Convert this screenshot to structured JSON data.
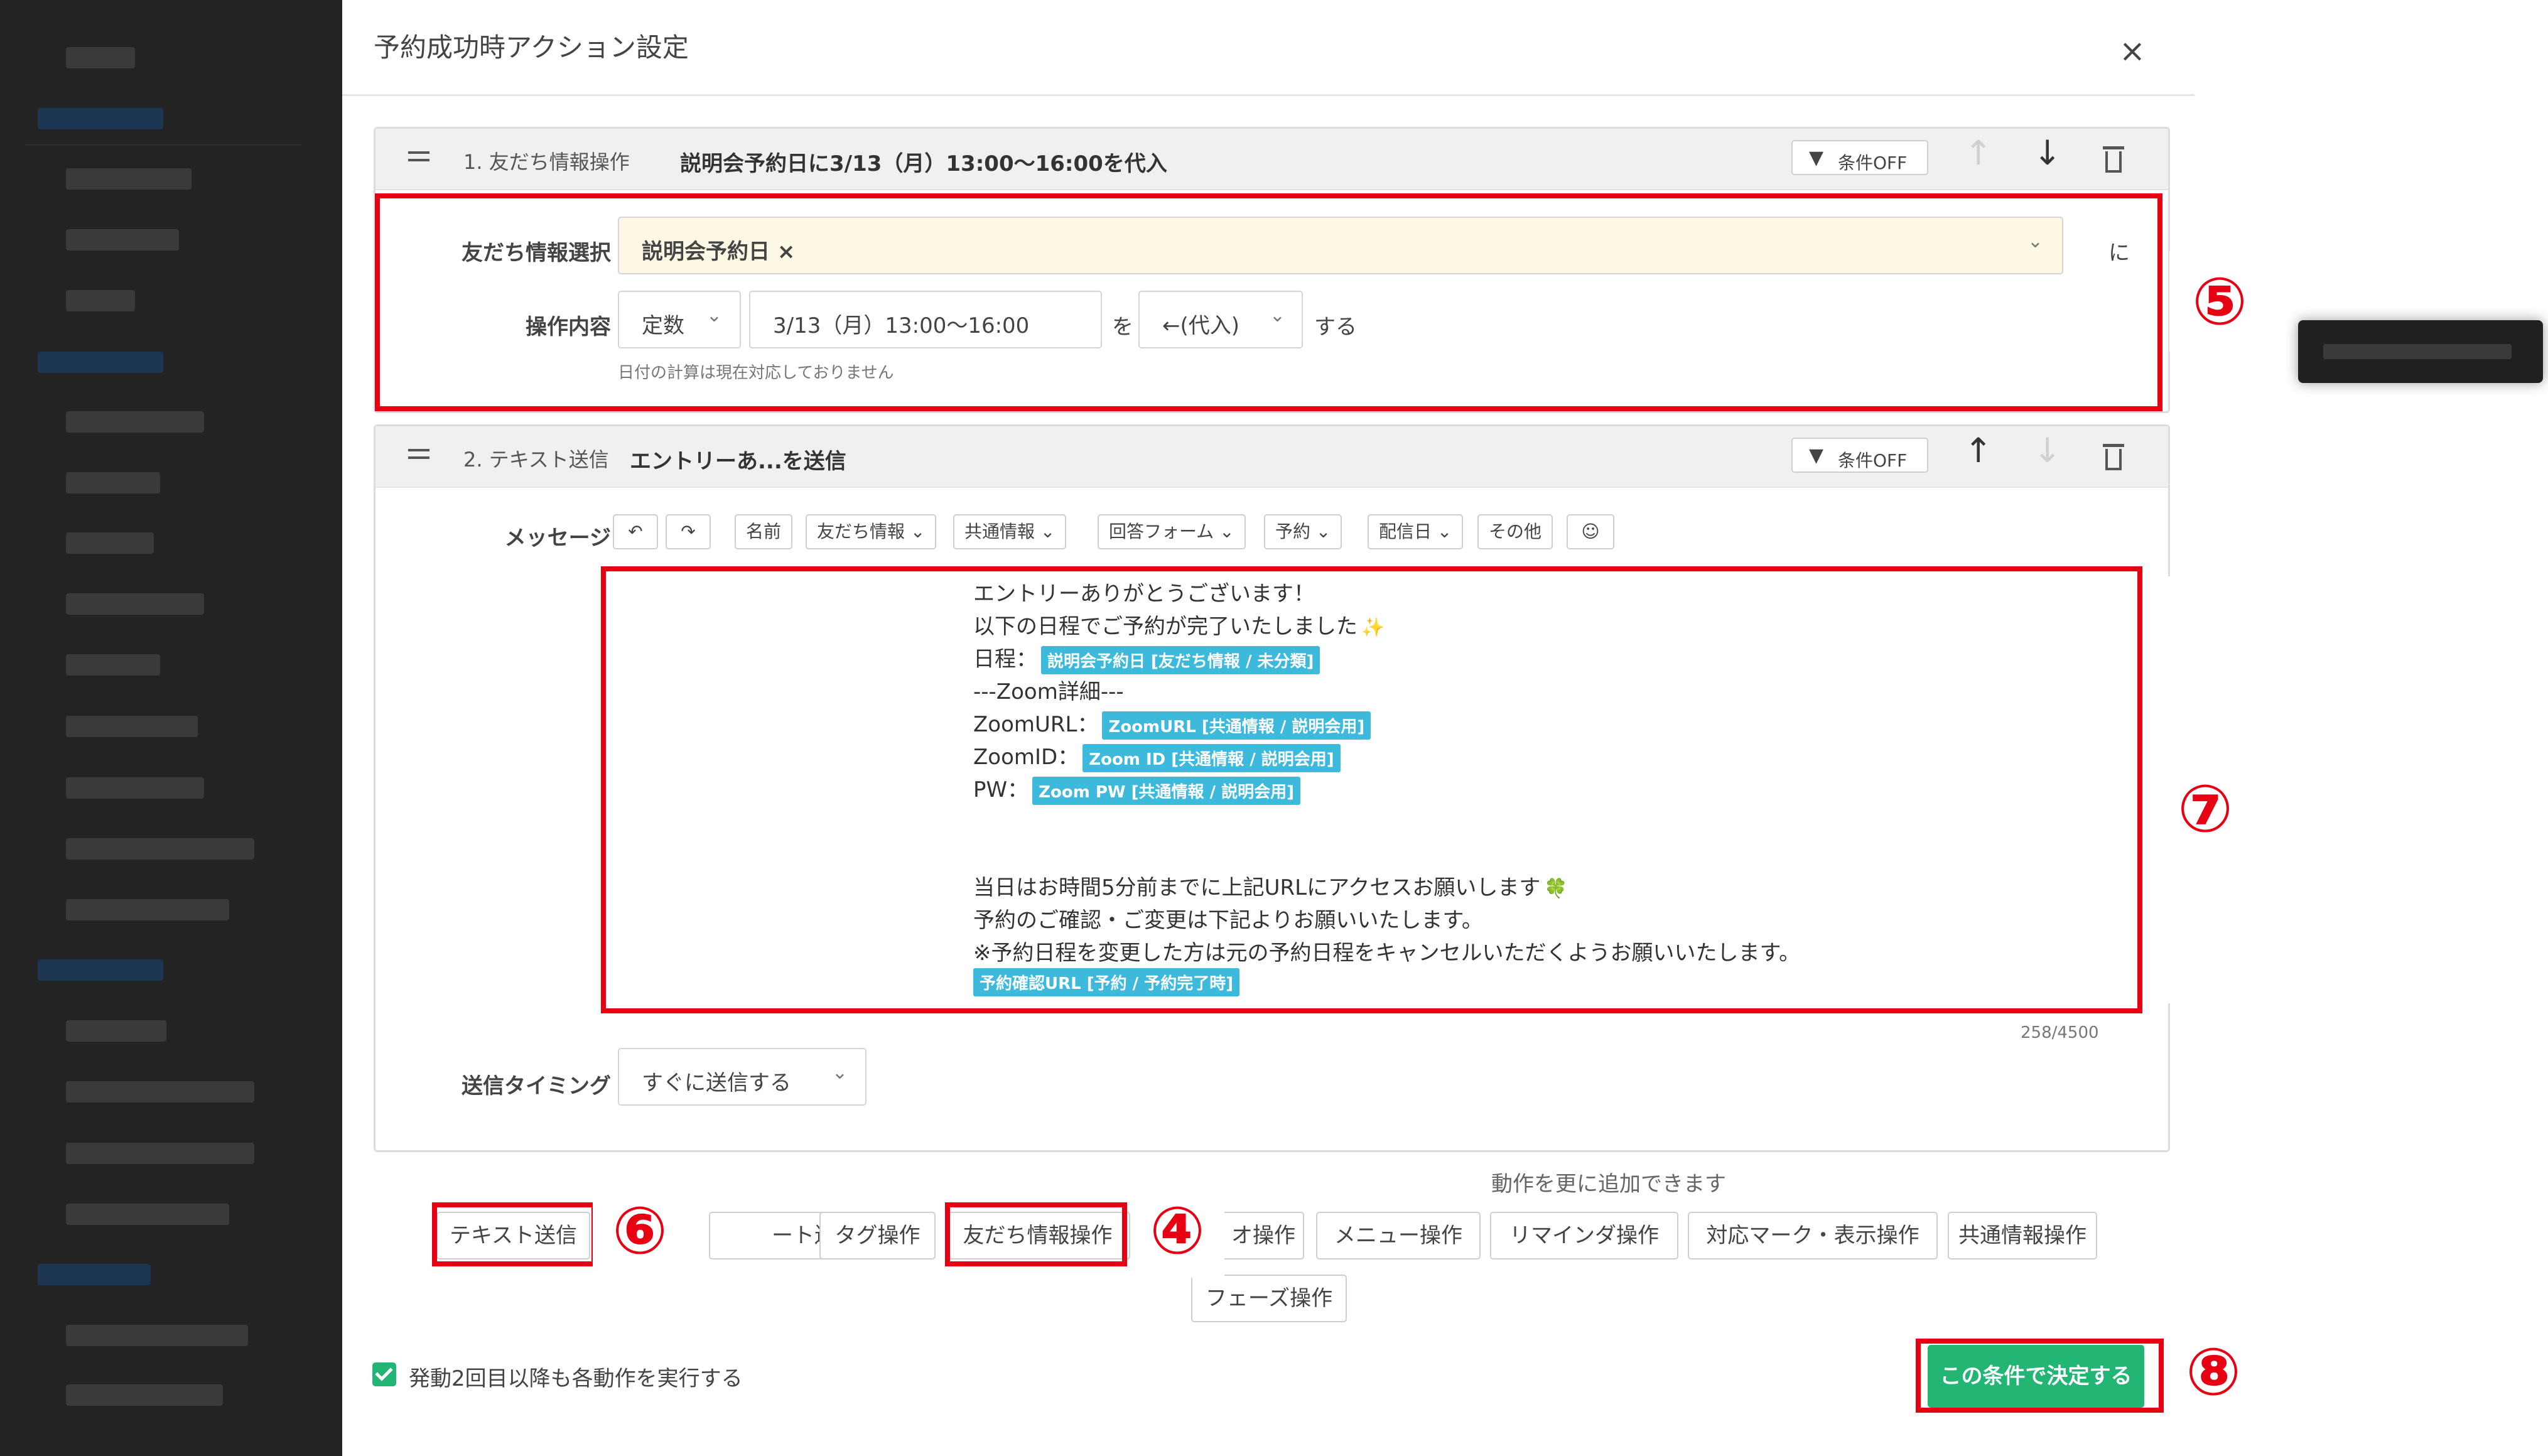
{
  "modal": {
    "title": "予約成功時アクション設定",
    "close_icon": "close-icon"
  },
  "action1": {
    "number": "1. 友だち情報操作",
    "summary": "説明会予約日に3/13（月）13:00〜16:00を代入",
    "condition_button": "条件OFF",
    "friend_info_label": "友だち情報選択",
    "friend_info_value": "説明会予約日",
    "friend_info_remove": "×",
    "friend_info_suffix": "に",
    "operation_label": "操作内容",
    "operation_type": "定数",
    "operation_value": "3/13（月）13:00〜16:00",
    "particle_wo": "を",
    "operation_mode": "←(代入)",
    "suru": "する",
    "note": "日付の計算は現在対応しておりません"
  },
  "action2": {
    "number": "2. テキスト送信",
    "summary": "エントリーあ...を送信",
    "condition_button": "条件OFF",
    "message_label": "メッセージ",
    "toolbar": {
      "undo": "↶",
      "redo": "↷",
      "name": "名前",
      "friend_info": "友だち情報",
      "shared_info": "共通情報",
      "answer_form": "回答フォーム",
      "reservation": "予約",
      "delivery_date": "配信日",
      "other": "その他",
      "emoji": "☺",
      "caret": "⌄"
    },
    "message": {
      "line1": "エントリーありがとうございます！",
      "line2": "以下の日程でご予約が完了いたしました",
      "line2_emoji": "✨",
      "line3_prefix": "日程：",
      "line3_tag": "説明会予約日 [友だち情報 / 未分類]",
      "line4": "---Zoom詳細---",
      "line5_prefix": "ZoomURL：",
      "line5_tag": "ZoomURL [共通情報 / 説明会用]",
      "line6_prefix": "ZoomID：",
      "line6_tag": "Zoom ID [共通情報 / 説明会用]",
      "line7_prefix": "PW：",
      "line7_tag": "Zoom PW [共通情報 / 説明会用]",
      "line8": "当日はお時間5分前までに上記URLにアクセスお願いします",
      "line8_emoji": "🍀",
      "line9": "予約のご確認・ご変更は下記よりお願いいたします。",
      "line10": "※予約日程を変更した方は元の予約日程をキャンセルいただくようお願いいたします。",
      "line11_tag": "予約確認URL [予約 / 予約完了時]"
    },
    "char_count": "258/4500",
    "timing_label": "送信タイミング",
    "timing_value": "すぐに送信する"
  },
  "add_actions": {
    "label": "動作を更に追加できます",
    "buttons": [
      "テキスト送信",
      "ート送信",
      "タグ操作",
      "友だち情報操作",
      "オ操作",
      "メニュー操作",
      "リマインダ操作",
      "対応マーク・表示操作",
      "共通情報操作",
      "フェーズ操作"
    ]
  },
  "footer": {
    "checkbox_label": "発動2回目以降も各動作を実行する",
    "decide_button": "この条件で決定する"
  },
  "callouts": [
    "④",
    "⑤",
    "⑥",
    "⑦",
    "⑧"
  ],
  "colors": {
    "accent_green": "#22b573",
    "tag_blue": "#3db9dc",
    "highlight_red": "#e60012",
    "select_yellow": "#fdf8e4"
  }
}
